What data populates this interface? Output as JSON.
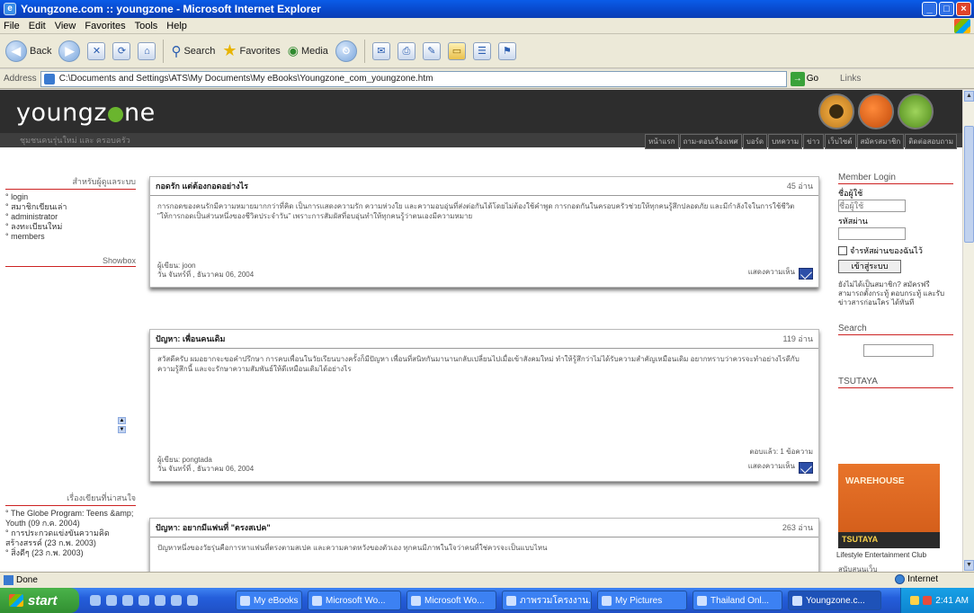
{
  "window": {
    "title": "Youngzone.com :: youngzone - Microsoft Internet Explorer"
  },
  "menu": [
    "File",
    "Edit",
    "View",
    "Favorites",
    "Tools",
    "Help"
  ],
  "toolbar": {
    "back": "Back",
    "search": "Search",
    "favorites": "Favorites",
    "media": "Media"
  },
  "address": {
    "label": "Address",
    "value": "C:\\Documents and Settings\\ATS\\My Documents\\My eBooks\\Youngzone_com_youngzone.htm",
    "go": "Go",
    "links": "Links"
  },
  "site": {
    "logo_left": "youngz",
    "logo_right": "ne",
    "tagline": "ชุมชนคนรุ่นใหม่ และ ครอบครัว",
    "nav": [
      "หน้าแรก",
      "ถาม-ตอบเรื่องเพศ",
      "บอร์ด",
      "บทความ",
      "ข่าว",
      "เว็บไซต์",
      "สมัครสมาชิก",
      "ติดต่อสอบถาม"
    ]
  },
  "left": {
    "heading": "สำหรับผู้ดูแลระบบ",
    "links": [
      "login",
      "สมาชิกเขียนเล่า",
      "administrator",
      "ลงทะเบียนใหม่",
      "members"
    ],
    "showbox": "Showbox",
    "recent_heading": "เรื่องเขียนที่น่าสนใจ",
    "recent": [
      "The Globe Program: Teens &amp; Youth (09 ก.ค. 2004)",
      "การประกวดแข่งขันความคิดสร้างสรรค์ (23 ก.พ. 2003)",
      "สิ่งดีๆ (23 ก.พ. 2003)"
    ]
  },
  "posts": [
    {
      "title": "กอดรัก แต่ต้องกอดอย่างไร",
      "reads": "45 อ่าน",
      "body": "การกอดของคนรักมีความหมายมากกว่าที่คิด เป็นการแสดงความรัก ความห่วงใย และความอบอุ่นที่ส่งต่อกันได้โดยไม่ต้องใช้คำพูด การกอดกันในครอบครัวช่วยให้ทุกคนรู้สึกปลอดภัย และมีกำลังใจในการใช้ชีวิต \"ให้การกอดเป็นส่วนหนึ่งของชีวิตประจำวัน\" เพราะการสัมผัสที่อบอุ่นทำให้ทุกคนรู้ว่าตนเองมีความหมาย",
      "author": "ผู้เขียน: joon",
      "date": "วัน จันทร์ที่ , ธันวาคม 06, 2004",
      "more": "แสดงความเห็น",
      "extra": ""
    },
    {
      "title": "ปัญหา: เพื่อนคนเดิม",
      "reads": "119 อ่าน",
      "body": "สวัสดีครับ ผมอยากจะขอคำปรึกษา การคบเพื่อนในวัยเรียนบางครั้งก็มีปัญหา เพื่อนที่สนิทกันมานานกลับเปลี่ยนไปเมื่อเข้าสังคมใหม่ ทำให้รู้สึกว่าไม่ได้รับความสำคัญเหมือนเดิม อยากทราบว่าควรจะทำอย่างไรดีกับความรู้สึกนี้ และจะรักษาความสัมพันธ์ให้ดีเหมือนเดิมได้อย่างไร",
      "author": "ผู้เขียน: pongtada",
      "date": "วัน จันทร์ที่ , ธันวาคม 06, 2004",
      "more": "แสดงความเห็น",
      "extra": "ตอบแล้ว: 1 ข้อความ"
    },
    {
      "title": "ปัญหา: อยากมีแฟนที่ \"ตรงสเปค\"",
      "reads": "263 อ่าน",
      "body": "ปัญหาหนึ่งของวัยรุ่นคือการหาแฟนที่ตรงตามสเปค และความคาดหวังของตัวเอง ทุกคนมีภาพในใจว่าคนที่ใช่ควรจะเป็นแบบไหน"
    }
  ],
  "right": {
    "login_heading": "Member Login",
    "username_label": "ชื่อผู้ใช้",
    "username_placeholder": "ชื่อผู้ใช้",
    "password_label": "รหัสผ่าน",
    "remember": "จำรหัสผ่านของฉันไว้",
    "login_button": "เข้าสู่ระบบ",
    "info": "ยังไม่ได้เป็นสมาชิก? สมัครฟรี สามารถตั้งกระทู้ ตอบกระทู้ และรับข่าวสารก่อนใคร ได้ทันที",
    "search_heading": "Search",
    "tsutaya_heading": "TSUTAYA",
    "banner_text": "WAREHOUSE",
    "banner_strip": "TSUTAYA",
    "banner_caption": "Lifestyle Entertainment Club",
    "more_heading": "สนับสนุนเว็บ"
  },
  "status": {
    "text": "Done",
    "zone": "Internet"
  },
  "taskbar": {
    "start": "start",
    "tasks": [
      "My eBooks",
      "Microsoft Wo...",
      "Microsoft Wo...",
      "ภาพรวมโครงงาน...",
      "My Pictures",
      "Thailand Onl...",
      "Youngzone.c..."
    ],
    "clock": "2:41 AM"
  }
}
